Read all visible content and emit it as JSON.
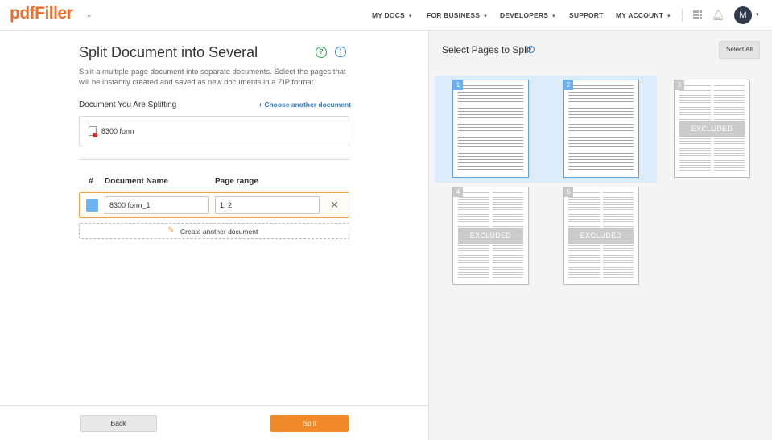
{
  "header": {
    "logo": "pdfFiller",
    "nav": [
      "MY DOCS",
      "FOR BUSINESS",
      "DEVELOPERS",
      "SUPPORT",
      "MY ACCOUNT"
    ],
    "avatar_initial": "M"
  },
  "left": {
    "title": "Split Document into Several",
    "description": "Split a multiple-page document into separate documents. Select the pages that will be instantly created and saved as new documents in a ZIP format.",
    "doc_label": "Document You Are Splitting",
    "choose_link": "+ Choose another document",
    "doc_name": "8300 form",
    "table_headers": [
      "#",
      "Document Name",
      "Page range"
    ],
    "rows": [
      {
        "color": "#6db4f0",
        "name": "8300 form_1",
        "range": "1, 2"
      }
    ],
    "add_label": "Create another document",
    "back_label": "Back",
    "split_label": "Split"
  },
  "right": {
    "title": "Select Pages to Split",
    "select_all": "Select All",
    "excluded_label": "EXCLUDED",
    "pages": [
      {
        "num": "1",
        "selected": true
      },
      {
        "num": "2",
        "selected": true
      },
      {
        "num": "3",
        "selected": false
      },
      {
        "num": "4",
        "selected": false
      },
      {
        "num": "5",
        "selected": false
      }
    ]
  },
  "colors": {
    "accent": "#f08a2a",
    "link": "#2e7fd8",
    "selected": "#5aa3e8"
  }
}
